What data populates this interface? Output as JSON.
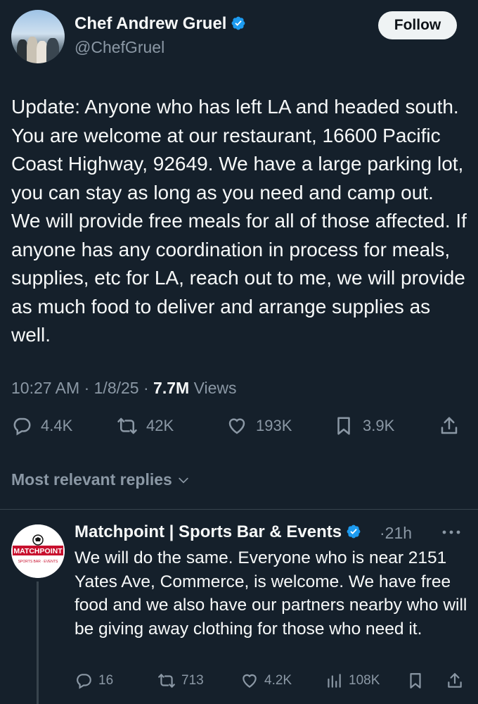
{
  "tweet": {
    "author_name": "Chef Andrew Gruel",
    "author_handle": "@ChefGruel",
    "follow_label": "Follow",
    "text": "Update: Anyone who has left LA and headed south. You are welcome at our restaurant, 16600 Pacific Coast Highway, 92649. We have a large parking lot, you can stay as long as you need and camp out. We will provide free meals for all of those affected. If anyone has any coordination in process for meals, supplies, etc for LA, reach out to me, we will provide as much food to deliver and arrange supplies as well.",
    "time": "10:27 AM",
    "date": "1/8/25",
    "views_count": "7.7M",
    "views_label": "Views",
    "replies": "4.4K",
    "reposts": "42K",
    "likes": "193K",
    "bookmarks": "3.9K"
  },
  "sort_label": "Most relevant replies",
  "reply": {
    "author_name": "Matchpoint | Sports Bar & Events",
    "time": "21h",
    "avatar_text": "MATCHPOINT",
    "avatar_subtext": "SPORTS BAR · EVENTS",
    "text": "We will do the same. Everyone who is near 2151 Yates Ave, Commerce, is welcome. We have free food and we also have our partners nearby who will be giving away clothing for those who need it.",
    "replies": "16",
    "reposts": "713",
    "likes": "4.2K",
    "views": "108K"
  },
  "colors": {
    "background": "#15202b",
    "text": "#f7f9f9",
    "muted": "#8b98a5",
    "verified": "#1d9bf0",
    "divider": "#38444d"
  }
}
